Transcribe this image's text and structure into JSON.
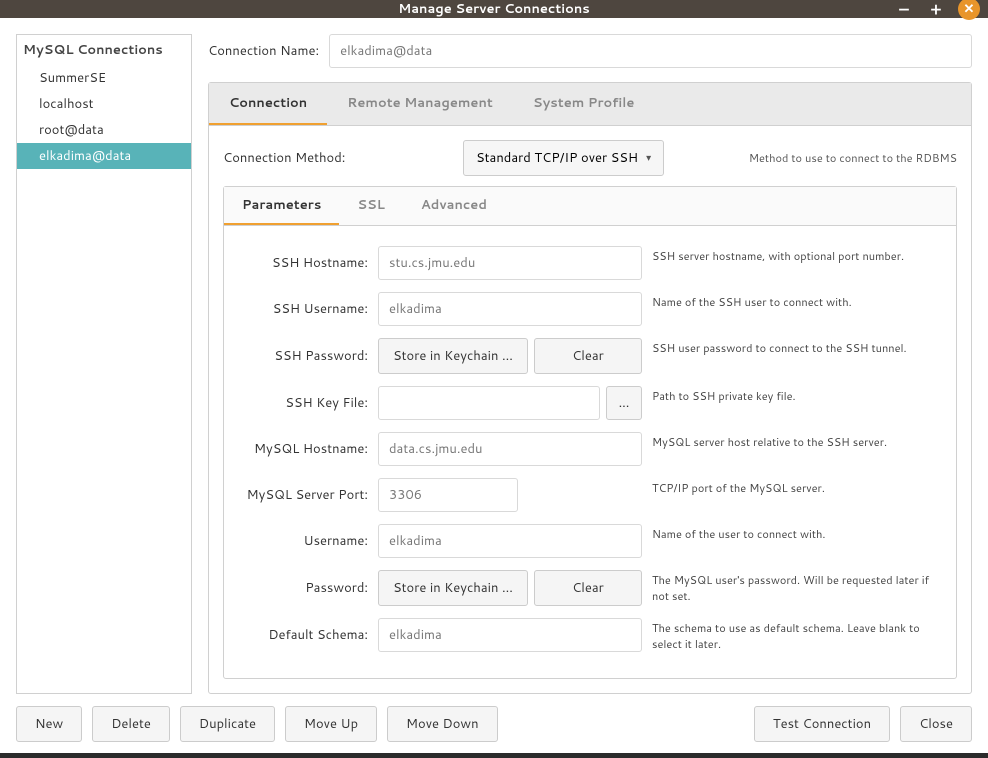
{
  "window": {
    "title": "Manage Server Connections"
  },
  "sidebar": {
    "header": "MySQL Connections",
    "items": [
      {
        "label": "SummerSE"
      },
      {
        "label": "localhost"
      },
      {
        "label": "root@data"
      },
      {
        "label": "elkadima@data"
      }
    ]
  },
  "connNameLabel": "Connection Name:",
  "connNameValue": "elkadima@data",
  "tabs": {
    "connection": "Connection",
    "remote": "Remote Management",
    "profile": "System Profile"
  },
  "method": {
    "label": "Connection Method:",
    "value": "Standard TCP/IP over SSH",
    "hint": "Method to use to connect to the RDBMS"
  },
  "subtabs": {
    "parameters": "Parameters",
    "ssl": "SSL",
    "advanced": "Advanced"
  },
  "fields": {
    "sshHost": {
      "label": "SSH Hostname:",
      "value": "stu.cs.jmu.edu",
      "hint": "SSH server hostname, with  optional port number."
    },
    "sshUser": {
      "label": "SSH Username:",
      "value": "elkadima",
      "hint": "Name of the SSH user to connect with."
    },
    "sshPass": {
      "label": "SSH Password:",
      "store": "Store in Keychain ...",
      "clear": "Clear",
      "hint": "SSH user password to connect to the SSH tunnel."
    },
    "sshKey": {
      "label": "SSH Key File:",
      "value": "",
      "browse": "...",
      "hint": "Path to SSH private key file."
    },
    "mysqlHost": {
      "label": "MySQL Hostname:",
      "value": "data.cs.jmu.edu",
      "hint": "MySQL server host relative to the SSH server."
    },
    "mysqlPort": {
      "label": "MySQL Server Port:",
      "value": "3306",
      "hint": "TCP/IP port of the MySQL server."
    },
    "username": {
      "label": "Username:",
      "value": "elkadima",
      "hint": "Name of the user to connect with."
    },
    "password": {
      "label": "Password:",
      "store": "Store in Keychain ...",
      "clear": "Clear",
      "hint": "The MySQL user's password. Will be requested later if not set."
    },
    "schema": {
      "label": "Default Schema:",
      "value": "elkadima",
      "hint": "The schema to use as default schema. Leave blank to select it later."
    }
  },
  "footer": {
    "new": "New",
    "delete": "Delete",
    "duplicate": "Duplicate",
    "moveUp": "Move Up",
    "moveDown": "Move Down",
    "test": "Test Connection",
    "close": "Close"
  }
}
